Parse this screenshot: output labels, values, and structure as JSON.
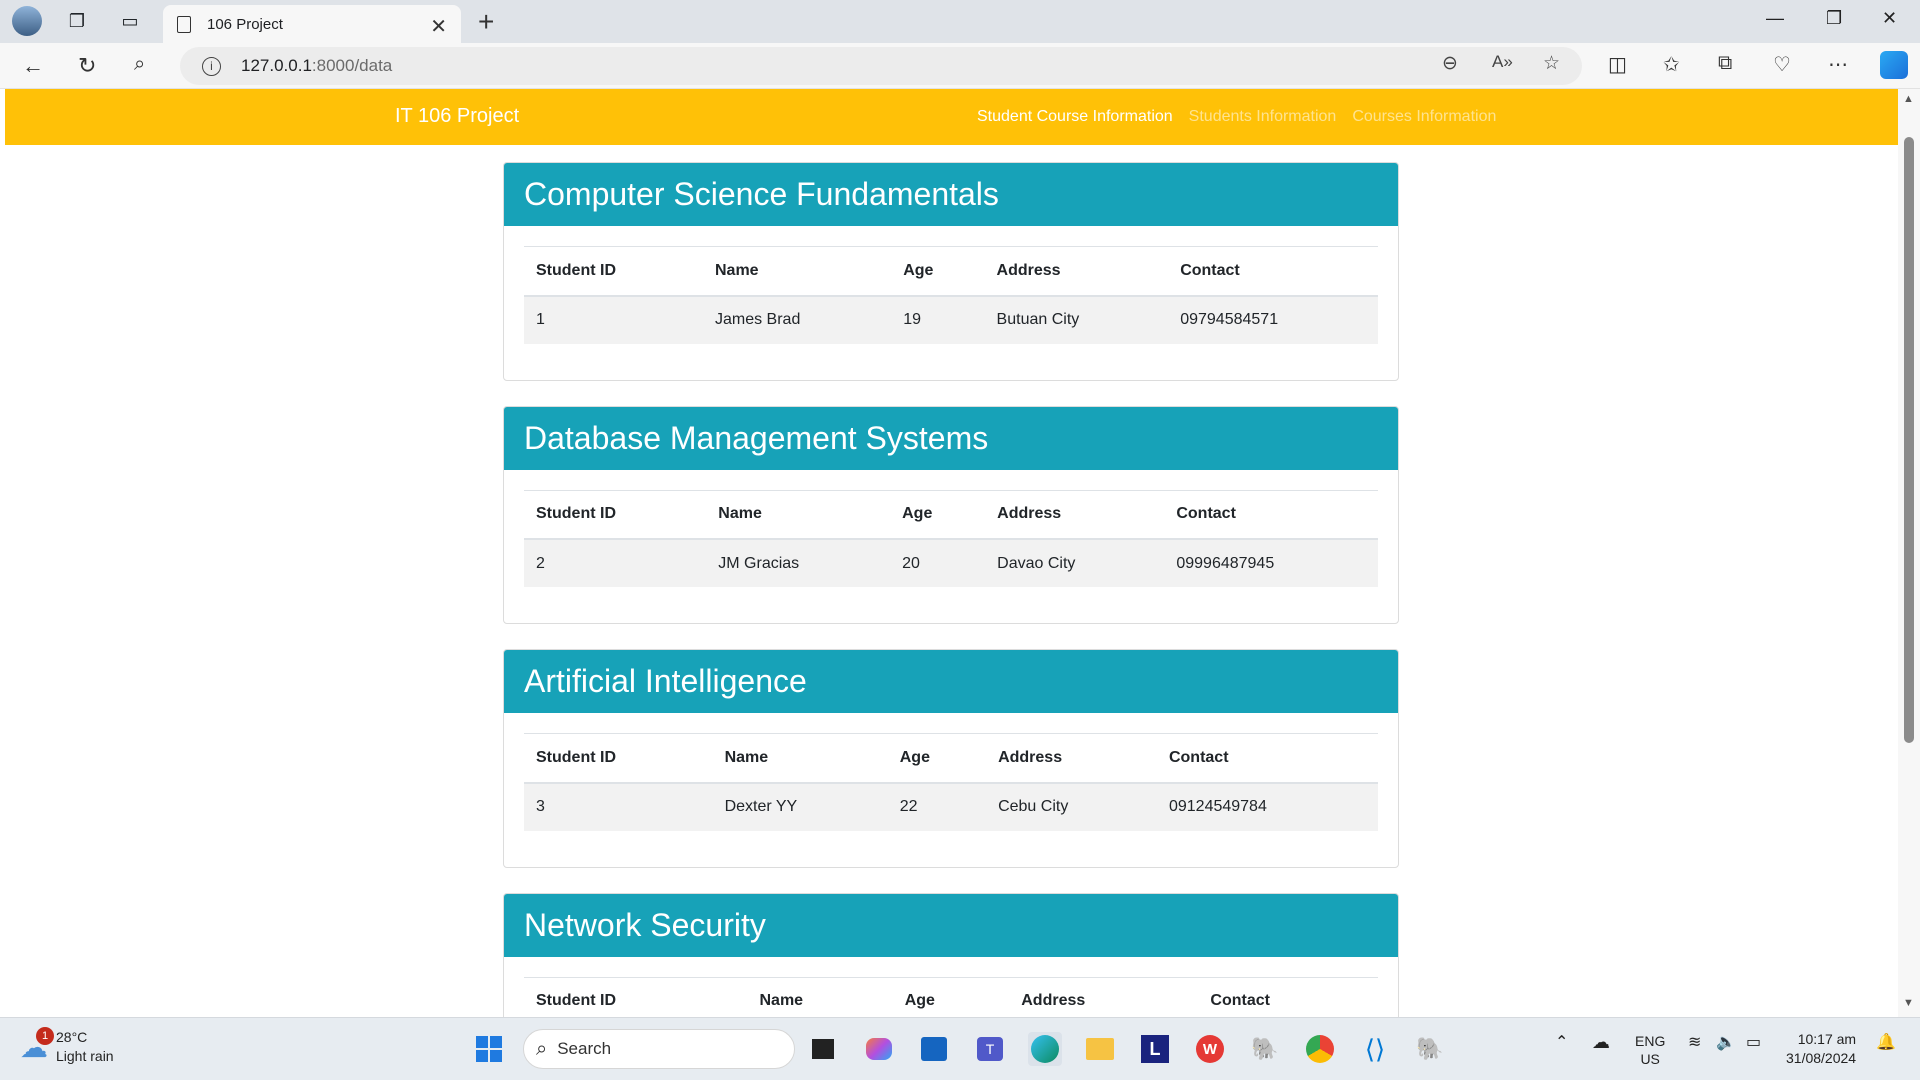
{
  "browser": {
    "tab_title": "106 Project",
    "url_host": "127.0.0.1",
    "url_path": ":8000/data"
  },
  "navbar": {
    "brand": "IT 106 Project",
    "links": [
      "Student Course Information",
      "Students Information",
      "Courses Information"
    ],
    "active_index": 0,
    "color": "#ffc107"
  },
  "table_headers": [
    "Student ID",
    "Name",
    "Age",
    "Address",
    "Contact"
  ],
  "courses": [
    {
      "title": "Computer Science Fundamentals",
      "rows": [
        [
          "1",
          "James Brad",
          "19",
          "Butuan City",
          "09794584571"
        ]
      ]
    },
    {
      "title": "Database Management Systems",
      "rows": [
        [
          "2",
          "JM Gracias",
          "20",
          "Davao City",
          "09996487945"
        ]
      ]
    },
    {
      "title": "Artificial Intelligence",
      "rows": [
        [
          "3",
          "Dexter YY",
          "22",
          "Cebu City",
          "09124549784"
        ]
      ]
    },
    {
      "title": "Network Security",
      "rows": []
    }
  ],
  "card_header_color": "#17a2b8",
  "taskbar": {
    "weather_temp": "28°C",
    "weather_desc": "Light rain",
    "weather_badge": "1",
    "search_placeholder": "Search",
    "lang_top": "ENG",
    "lang_bottom": "US",
    "time": "10:17 am",
    "date": "31/08/2024"
  }
}
